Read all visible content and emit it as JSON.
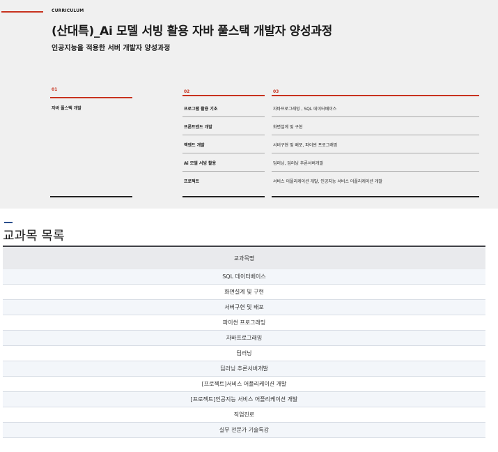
{
  "header": {
    "eyebrow": "CURRICULUM",
    "title": "(산대특)_Ai 모델 서빙 활용 자바 풀스택 개발자 양성과정",
    "subtitle": "인공지능을 적용한 서버 개발자 양성과정"
  },
  "columns": [
    {
      "num": "01",
      "items": [
        "자바 풀스택 개발"
      ]
    },
    {
      "num": "02",
      "items": [
        "프로그램 활용 기초",
        "프론트엔드 개발",
        "백엔드 개발",
        "Ai 모델 서빙 활용",
        "프로젝트"
      ]
    },
    {
      "num": "03",
      "items": [
        "자바프로그래밍 , SQL 데이터베이스",
        "화면설계 및 구현",
        "서버구현 및 배포, 파이썬 프로그래밍",
        "딥러닝, 딥러닝 추론서버개발",
        "서비스 어플리케이션 개발, 인공지능 서비스 어플리케이션 개발"
      ]
    }
  ],
  "subjects": {
    "section_title": "교과목 목록",
    "header": "교과목명",
    "rows": [
      "SQL 데이터베이스",
      "화면설계 및 구현",
      "서버구현 및 배포",
      "파이썬 프로그래밍",
      "자바프로그래밍",
      "딥러닝",
      "딥러닝 추론서버개발",
      "[프로젝트]서비스 어플리케이션 개발",
      "[프로젝트]인공지능 서비스 어플리케이션 개발",
      "직업진로",
      "실무 전문가 기술특강"
    ]
  }
}
